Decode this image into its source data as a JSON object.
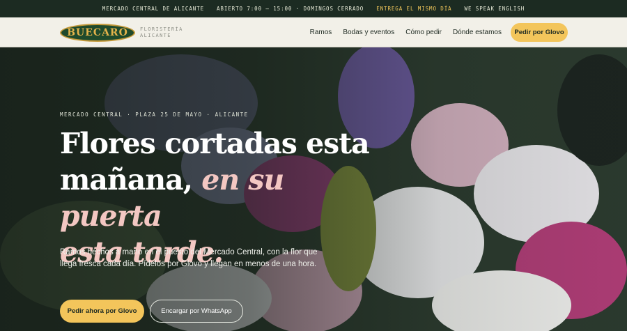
{
  "topbar": {
    "location": "MERCADO CENTRAL DE ALICANTE",
    "hours": "ABIERTO 7:00 – 15:00 · DOMINGOS CERRADO",
    "delivery": "ENTREGA EL MISMO DÍA",
    "language": "WE SPEAK ENGLISH"
  },
  "brand": {
    "logo": "BUECARO",
    "tagline_line1": "FLORISTERÍA",
    "tagline_line2": "ALICANTE"
  },
  "nav": {
    "items": [
      "Ramos",
      "Bodas y eventos",
      "Cómo pedir",
      "Dónde estamos"
    ],
    "cta": "Pedir por Glovo"
  },
  "hero": {
    "eyebrow": "MERCADO CENTRAL · PLAZA 25 DE MAYO · ALICANTE",
    "headline_plain_1": "Flores cortadas esta",
    "headline_plain_2": "mañana, ",
    "headline_italic_1": "en su puerta",
    "headline_italic_2": "esta tarde.",
    "lead": "Ramos hechos a mano en el puesto del Mercado Central, con la flor que llega fresca cada día. Pídelos por Glovo y llegan en menos de una hora.",
    "primary_cta": "Pedir ahora por Glovo",
    "secondary_cta": "Encargar por WhatsApp"
  },
  "colors": {
    "topbar_bg": "#1c2b22",
    "accent_yellow": "#f3c55b",
    "italic_pink": "#f3c7c2",
    "nav_bg": "#f2f0e8"
  }
}
